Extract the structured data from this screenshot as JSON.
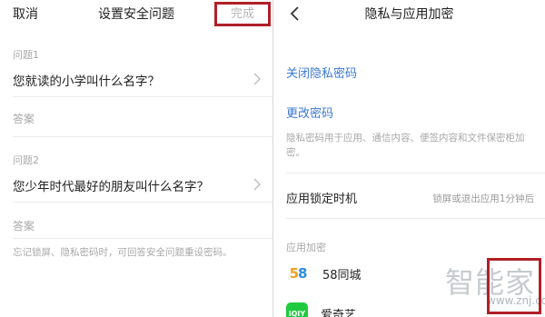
{
  "left_screen": {
    "cancel_label": "取消",
    "title": "设置安全问题",
    "done_label": "完成",
    "question1_label": "问题1",
    "question1_text": "您就读的小学叫什么名字？",
    "answer1_label": "答案",
    "question2_label": "问题2",
    "question2_text": "您少年时代最好的朋友叫什么名字？",
    "answer2_label": "答案",
    "hint": "忘记锁屏、隐私密码时，可回答安全问题重设密码。"
  },
  "right_screen": {
    "title": "隐私与应用加密",
    "close_privacy_password": "关闭隐私密码",
    "change_password": "更改密码",
    "privacy_description": "隐私密码用于应用、通信内容、便签内容和文件保密柜加密。",
    "lock_timing_label": "应用锁定时机",
    "lock_timing_value": "锁屏或退出应用1分钟后",
    "app_encryption_section": "应用加密",
    "apps": [
      {
        "name": "58同城",
        "icon_text": "58"
      },
      {
        "name": "爱奇艺",
        "icon_text": "iQIY"
      }
    ]
  },
  "watermark": {
    "text": "智能家",
    "url": "www.znj.com"
  },
  "colors": {
    "accent_link": "#3b78cf",
    "highlight_box": "#b02028",
    "iqiyi_green": "#1fca3f",
    "muted_text": "#a8a8a8"
  }
}
